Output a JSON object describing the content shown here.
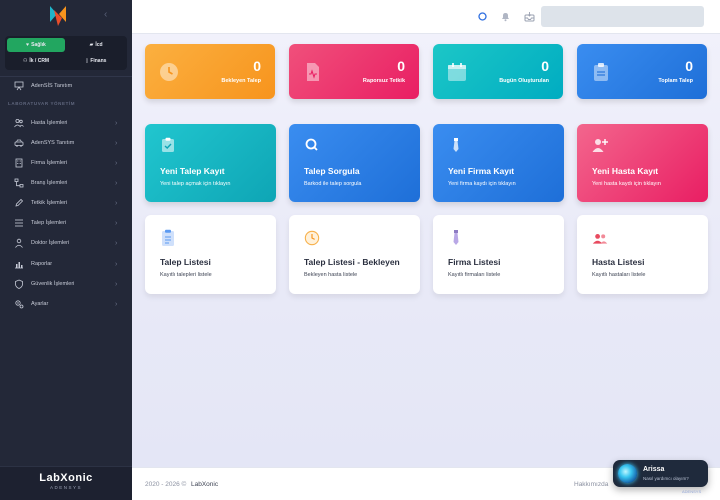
{
  "sidebar": {
    "modules": [
      {
        "label": "Sağlık",
        "active": true
      },
      {
        "label": "İcd"
      },
      {
        "label": "İk / CRM"
      },
      {
        "label": "Finans"
      }
    ],
    "intro_item": "AdenSİS Tanıtım",
    "section_label": "LABORATUVAR YÖNETİM",
    "items": [
      {
        "label": "Hasta İşlemleri",
        "icon": "users-icon"
      },
      {
        "label": "AdenSYS Tanıtım",
        "icon": "car-icon"
      },
      {
        "label": "Firma İşlemleri",
        "icon": "building-icon"
      },
      {
        "label": "Branş İşlemleri",
        "icon": "branch-icon"
      },
      {
        "label": "Tetkik İşlemleri",
        "icon": "pencil-icon"
      },
      {
        "label": "Talep İşlemleri",
        "icon": "list-icon"
      },
      {
        "label": "Doktor İşlemleri",
        "icon": "doctor-icon"
      },
      {
        "label": "Raporlar",
        "icon": "chart-icon"
      },
      {
        "label": "Güvenlik İşlemleri",
        "icon": "shield-icon"
      },
      {
        "label": "Ayarlar",
        "icon": "gear-icon"
      }
    ],
    "brand": {
      "name": "LabXonic",
      "sub": "ADENSYS"
    }
  },
  "stats": [
    {
      "value": "0",
      "label": "Bekleyen Talep",
      "icon": "clock-icon",
      "color": "#f7941d"
    },
    {
      "value": "0",
      "label": "Raporsuz Tetkik",
      "icon": "report-icon",
      "color": "#e91e63"
    },
    {
      "value": "0",
      "label": "Bugün Oluşturulan",
      "icon": "calendar-icon",
      "color": "#00acc1"
    },
    {
      "value": "0",
      "label": "Toplam Talep",
      "icon": "clipboard-icon",
      "color": "#1e6fd8"
    }
  ],
  "actions": [
    {
      "title": "Yeni Talep Kayıt",
      "desc": "Yeni talep açmak için tıklayın",
      "icon": "clipboard-check-icon"
    },
    {
      "title": "Talep Sorgula",
      "desc": "Barkod ile talep sorgula",
      "icon": "search-icon"
    },
    {
      "title": "Yeni Firma Kayıt",
      "desc": "Yeni firma kaydı için tıklayın",
      "icon": "tie-icon"
    },
    {
      "title": "Yeni Hasta Kayıt",
      "desc": "Yeni hasta kaydı için tıklayın",
      "icon": "user-plus-icon"
    }
  ],
  "lists": [
    {
      "title": "Talep Listesi",
      "desc": "Kayıtlı talepleri listele",
      "icon": "clipboard-list-icon"
    },
    {
      "title": "Talep Listesi - Bekleyen",
      "desc": "Bekleyen hasta listele",
      "icon": "clock-icon"
    },
    {
      "title": "Firma Listesi",
      "desc": "Kayıtlı firmaları listele",
      "icon": "tie-icon"
    },
    {
      "title": "Hasta Listesi",
      "desc": "Kayıtlı hastaları listele",
      "icon": "users-icon"
    }
  ],
  "footer": {
    "years": "2020 - 2026 ©",
    "brand": "LabXonic",
    "right": "Hakkımızda"
  },
  "assistant": {
    "name": "Arissa",
    "subtitle": "Nasıl yardımcı olayım?",
    "tag": "ADENSYS"
  }
}
